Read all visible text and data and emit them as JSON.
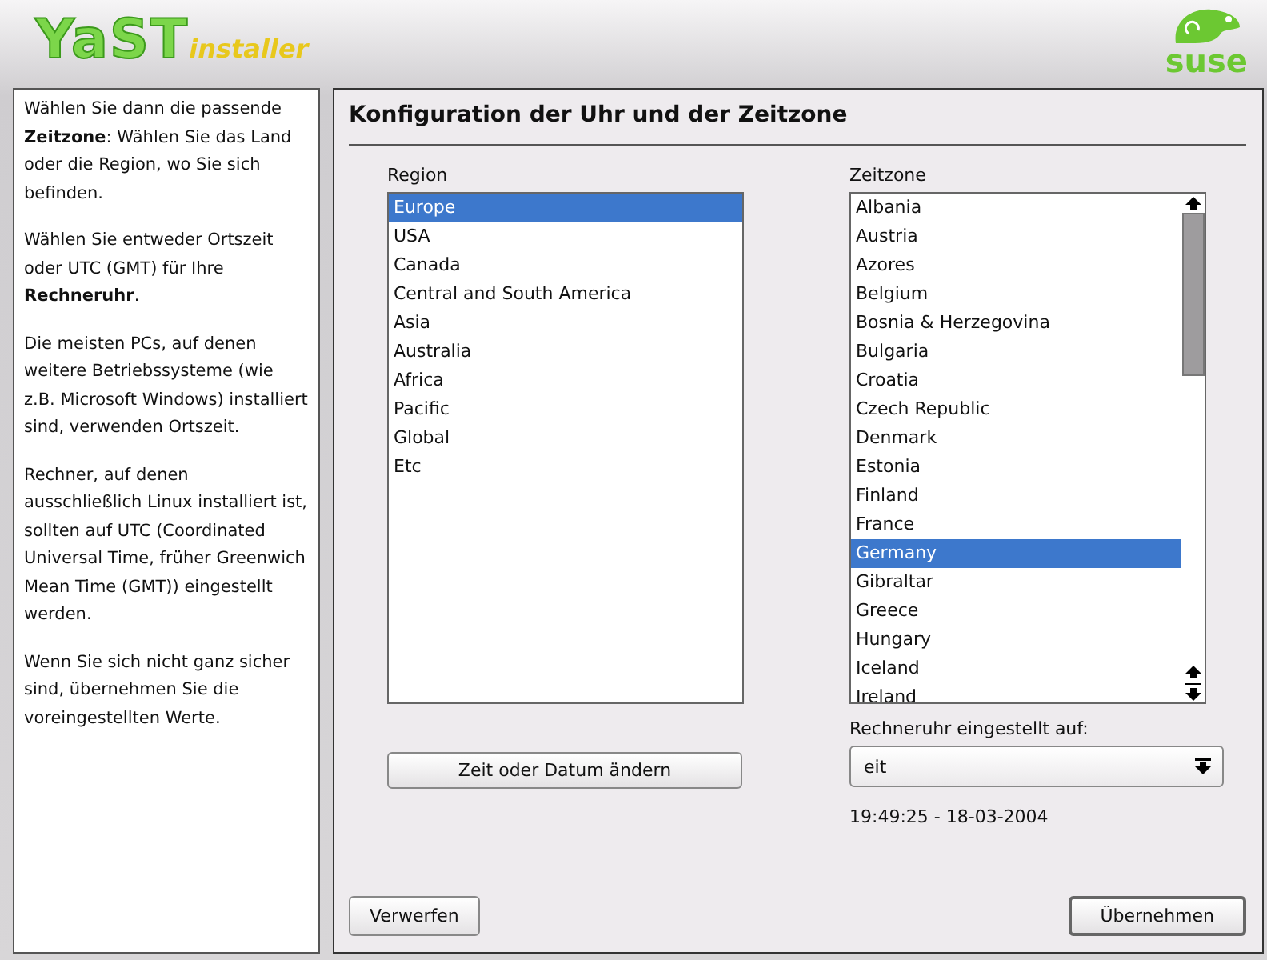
{
  "header": {
    "logo_main": "YaST",
    "logo_sub": "installer",
    "brand": "suse"
  },
  "help": [
    "Wählen Sie dann die passende **Zeitzone**: Wählen Sie das Land oder die Region, wo Sie sich befinden.",
    "Wählen Sie entweder Ortszeit oder UTC (GMT) für Ihre **Rechneruhr**.",
    "Die meisten PCs, auf denen weitere Betriebssysteme (wie z.B. Microsoft Windows) installiert sind, verwenden Ortszeit.",
    "Rechner, auf denen ausschließlich Linux installiert ist, sollten auf UTC (Coordinated Universal Time, früher Greenwich Mean Time (GMT)) eingestellt werden.",
    "Wenn Sie sich nicht ganz sicher sind, übernehmen Sie die voreingestellten Werte."
  ],
  "title": "Konfiguration der Uhr und der Zeitzone",
  "region": {
    "label": "Region",
    "items": [
      {
        "label": "Europe",
        "selected": true
      },
      {
        "label": "USA",
        "selected": false
      },
      {
        "label": "Canada",
        "selected": false
      },
      {
        "label": "Central and South America",
        "selected": false
      },
      {
        "label": "Asia",
        "selected": false
      },
      {
        "label": "Australia",
        "selected": false
      },
      {
        "label": "Africa",
        "selected": false
      },
      {
        "label": "Pacific",
        "selected": false
      },
      {
        "label": "Global",
        "selected": false
      },
      {
        "label": "Etc",
        "selected": false
      }
    ]
  },
  "timezone": {
    "label": "Zeitzone",
    "items": [
      {
        "label": "Albania",
        "selected": false
      },
      {
        "label": "Austria",
        "selected": false
      },
      {
        "label": "Azores",
        "selected": false
      },
      {
        "label": "Belgium",
        "selected": false
      },
      {
        "label": "Bosnia & Herzegovina",
        "selected": false
      },
      {
        "label": "Bulgaria",
        "selected": false
      },
      {
        "label": "Croatia",
        "selected": false
      },
      {
        "label": "Czech Republic",
        "selected": false
      },
      {
        "label": "Denmark",
        "selected": false
      },
      {
        "label": "Estonia",
        "selected": false
      },
      {
        "label": "Finland",
        "selected": false
      },
      {
        "label": "France",
        "selected": false
      },
      {
        "label": "Germany",
        "selected": true
      },
      {
        "label": "Gibraltar",
        "selected": false
      },
      {
        "label": "Greece",
        "selected": false
      },
      {
        "label": "Hungary",
        "selected": false
      },
      {
        "label": "Iceland",
        "selected": false
      },
      {
        "label": "Ireland",
        "selected": false
      }
    ]
  },
  "change_button": "Zeit oder Datum ändern",
  "clock": {
    "label": "Rechneruhr eingestellt auf:",
    "value": "eit"
  },
  "datetime": "19:49:25 - 18-03-2004",
  "buttons": {
    "discard": "Verwerfen",
    "accept": "Übernehmen"
  }
}
